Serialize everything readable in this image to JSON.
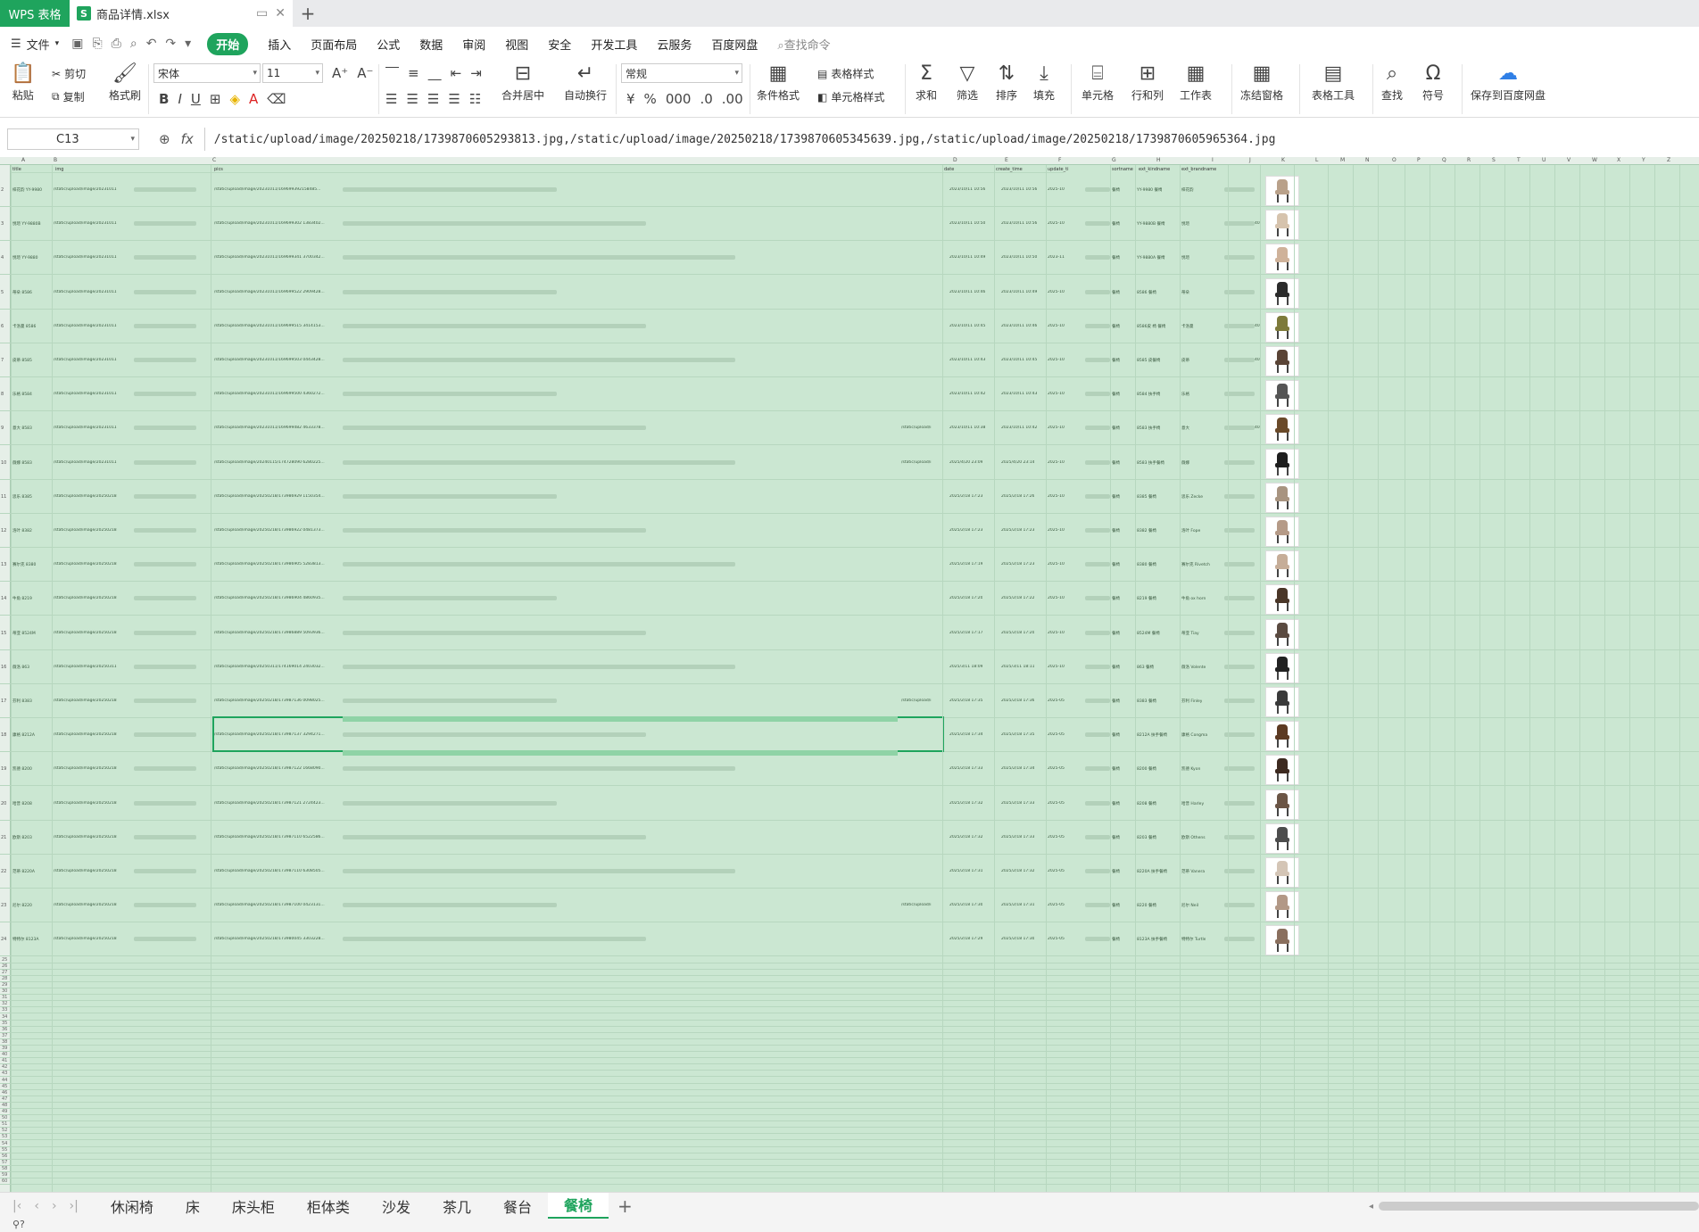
{
  "titlebar": {
    "app_label": "WPS 表格",
    "file_icon": "S",
    "file_name": "商品详情.xlsx",
    "new_tab": "+"
  },
  "menu": {
    "file": "文件",
    "items": [
      "开始",
      "插入",
      "页面布局",
      "公式",
      "数据",
      "审阅",
      "视图",
      "安全",
      "开发工具",
      "云服务",
      "百度网盘"
    ],
    "search": "查找命令"
  },
  "ribbon": {
    "paste": "粘贴",
    "cut": "剪切",
    "copy": "复制",
    "format_painter": "格式刷",
    "font_name": "宋体",
    "font_size": "11",
    "merge": "合并居中",
    "wrap": "自动换行",
    "number_format": "常规",
    "conditional": "条件格式",
    "table_style": "表格样式",
    "cell_style": "单元格样式",
    "sum": "求和",
    "filter": "筛选",
    "sort": "排序",
    "fill": "填充",
    "cell": "单元格",
    "rowcol": "行和列",
    "worksheet": "工作表",
    "freeze": "冻结窗格",
    "table_tools": "表格工具",
    "find": "查找",
    "symbol": "符号",
    "save_baidu": "保存到百度网盘",
    "bold": "B",
    "italic": "I",
    "underline": "U",
    "currency": "¥",
    "percent": "%",
    "thousands": "000"
  },
  "formula_bar": {
    "cell_ref": "C13",
    "fx": "fx",
    "content": "/static/upload/image/20250218/1739870605293813.jpg,/static/upload/image/20250218/1739870605345639.jpg,/static/upload/image/20250218/1739870605965364.jpg"
  },
  "columns": [
    "A",
    "B",
    "C",
    "D",
    "E",
    "F",
    "G",
    "H",
    "I",
    "J",
    "K",
    "L",
    "M",
    "N",
    "O",
    "P",
    "Q",
    "R",
    "S",
    "T",
    "U",
    "V",
    "W",
    "X",
    "Y",
    "Z"
  ],
  "header_row": {
    "A": "title",
    "B": "img",
    "C": "pics",
    "D": "date",
    "E": "create_time",
    "F": "update_ti",
    "G": "sortname",
    "H": "ext_kindname",
    "I": "ext_brandname"
  },
  "rows": [
    {
      "n": "2",
      "a": "梓花韵 YY-9980",
      "b": "/static/upload/image/20231011",
      "c": "/static/upload/image/20231011/169699392158485...",
      "cx": "",
      "d": "2023/10/11 10:56",
      "e": "2023/10/11 10:56",
      "f": "2025-10",
      "g": "餐椅",
      "h": "YY-9980 餐椅",
      "i": "梓花韵",
      "j": "",
      "col": "#b9a18a"
    },
    {
      "n": "3",
      "a": "悦瑄 YY-9880B",
      "b": "/static/upload/image/20231011",
      "c": "/static/upload/image/20231011/169699302 1383402...",
      "cx": "",
      "d": "2023/10/11 10:50",
      "e": "2023/10/11 10:56",
      "f": "2025-10",
      "g": "餐椅",
      "h": "YY-9880B 餐椅",
      "i": "悦瑄",
      "j": "40",
      "col": "#d6c3ad"
    },
    {
      "n": "4",
      "a": "悦瑄 YY-9880",
      "b": "/static/upload/image/20231011",
      "c": "/static/upload/image/20231011/169699341 3700342...",
      "cx": "",
      "d": "2023/10/11 10:49",
      "e": "2023/10/11 10:50",
      "f": "2023-11",
      "g": "餐椅",
      "h": "YY-9880A 餐椅",
      "i": "悦瑄",
      "j": "",
      "col": "#cfb29a"
    },
    {
      "n": "5",
      "a": "蒂朵 8586",
      "b": "/static/upload/image/20231011",
      "c": "/static/upload/image/20231011/169699522 2909428...",
      "cx": "",
      "d": "2023/10/11 10:46",
      "e": "2023/10/11 10:49",
      "f": "2025-10",
      "g": "餐椅",
      "h": "8586 餐椅",
      "i": "蒂朵",
      "j": "",
      "col": "#2b2b2b"
    },
    {
      "n": "6",
      "a": "卡洛曼 8586",
      "b": "/static/upload/image/20231011",
      "c": "/static/upload/image/20231011/169699515 3414153...",
      "cx": "",
      "d": "2023/10/11 10:45",
      "e": "2023/10/11 10:46",
      "f": "2025-10",
      "g": "餐椅",
      "h": "8586皮 椅 餐椅",
      "i": "卡洛曼",
      "j": "40",
      "col": "#7d7a3a"
    },
    {
      "n": "7",
      "a": "皮蒂 8585",
      "b": "/static/upload/image/20231011",
      "c": "/static/upload/image/20231011/169699503 0443428...",
      "cx": "",
      "d": "2023/10/11 10:43",
      "e": "2023/10/11 10:45",
      "f": "2025-10",
      "g": "餐椅",
      "h": "8585 皮餐椅",
      "i": "皮蒂",
      "j": "40",
      "col": "#5a4436"
    },
    {
      "n": "8",
      "a": "乐格 8584",
      "b": "/static/upload/image/20231011",
      "c": "/static/upload/image/20231011/169699500 4360272...",
      "cx": "",
      "d": "2023/10/11 10:42",
      "e": "2023/10/11 10:43",
      "f": "2025-10",
      "g": "餐椅",
      "h": "8584 扶手椅",
      "i": "乐格",
      "j": "",
      "col": "#555555"
    },
    {
      "n": "9",
      "a": "意大 8583",
      "b": "/static/upload/image/20231011",
      "c": "/static/upload/image/20231011/169699482 4633378...",
      "cx": "/static/upload/i",
      "d": "2023/10/11 10:38",
      "e": "2023/10/11 10:42",
      "f": "2025-10",
      "g": "餐椅",
      "h": "8583 扶手椅",
      "i": "意大",
      "j": "40",
      "col": "#6a4a2a"
    },
    {
      "n": "10",
      "a": "薇娜 8583",
      "b": "/static/upload/image/20231011",
      "c": "/static/upload/image/20240115/174728090 6280225...",
      "cx": "/static/upload/i",
      "d": "2025/4/20 23:09",
      "e": "2025/4/20 23:14",
      "f": "2025-10",
      "g": "餐椅",
      "h": "8583 扶手餐椅",
      "i": "薇娜",
      "j": "",
      "col": "#1e1e1e"
    },
    {
      "n": "11",
      "a": "思乐 8385",
      "b": "/static/upload/image/20250218",
      "c": "/static/upload/image/20250218/173986929 1150354...",
      "cx": "",
      "d": "2025/2/18 17:23",
      "e": "2025/2/18 17:26",
      "f": "2025-10",
      "g": "餐椅",
      "h": "8385 餐椅",
      "i": "思乐 Zecke",
      "j": "",
      "col": "#a89480"
    },
    {
      "n": "12",
      "a": "洛叶 8382",
      "b": "/static/upload/image/20250218",
      "c": "/static/upload/image/20250218/173986922 0481373...",
      "cx": "",
      "d": "2025/2/18 17:23",
      "e": "2025/2/18 17:23",
      "f": "2025-10",
      "g": "餐椅",
      "h": "8382 餐椅",
      "i": "洛叶 Fope",
      "j": "",
      "col": "#b59a87"
    },
    {
      "n": "13",
      "a": "赛尔克 8380",
      "b": "/static/upload/image/20250218",
      "c": "/static/upload/image/20250218/173986905 5283813...",
      "cx": "",
      "d": "2025/2/18 17:19",
      "e": "2025/2/18 17:23",
      "f": "2025-10",
      "g": "餐椅",
      "h": "8380 餐椅",
      "i": "赛尔克 Rivetch",
      "j": "",
      "col": "#c6ad98"
    },
    {
      "n": "14",
      "a": "牛角 8219",
      "b": "/static/upload/image/20250218",
      "c": "/static/upload/image/20250218/173986904 4860935...",
      "cx": "",
      "d": "2025/2/18 17:20",
      "e": "2025/2/18 17:22",
      "f": "2025-10",
      "g": "餐椅",
      "h": "8219 餐椅",
      "i": "牛角 ox horn",
      "j": "",
      "col": "#4a3628"
    },
    {
      "n": "15",
      "a": "蒂亚 8524M",
      "b": "/static/upload/image/20250218",
      "c": "/static/upload/image/20250218/173986889 5093936...",
      "cx": "",
      "d": "2025/2/18 17:17",
      "e": "2025/2/18 17:20",
      "f": "2025-10",
      "g": "餐椅",
      "h": "8524M 餐椅",
      "i": "蒂亚 Tiay",
      "j": "",
      "col": "#5a4a40"
    },
    {
      "n": "16",
      "a": "薇洛 863",
      "b": "/static/upload/image/20250311",
      "c": "/static/upload/image/20250311/174169014 2403032...",
      "cx": "",
      "d": "2025/3/11 18:09",
      "e": "2025/3/11 18:11",
      "f": "2025-10",
      "g": "餐椅",
      "h": "863 餐椅",
      "i": "薇洛 Volente",
      "j": "",
      "col": "#222222"
    },
    {
      "n": "17",
      "a": "芬利 8383",
      "b": "/static/upload/image/20250218",
      "c": "/static/upload/image/20250218/173987136 0098025...",
      "cx": "/static/upload/i",
      "d": "2025/2/18 17:35",
      "e": "2025/2/18 17:36",
      "f": "2025-05",
      "g": "餐椅",
      "h": "8383 餐椅",
      "i": "芬利 Finley",
      "j": "",
      "col": "#3a3a3a"
    },
    {
      "n": "18",
      "a": "康格 8212A",
      "b": "/static/upload/image/20250218",
      "c": "/static/upload/image/20250218/173987137 3294271...",
      "cx": "",
      "d": "2025/2/18 17:34",
      "e": "2025/2/18 17:35",
      "f": "2025-05",
      "g": "餐椅",
      "h": "8212A 扶手餐椅",
      "i": "康格 Congma",
      "j": "",
      "col": "#5c3a22"
    },
    {
      "n": "19",
      "a": "凯德 8200",
      "b": "/static/upload/image/20250218",
      "c": "/static/upload/image/20250218/173987122 1668090...",
      "cx": "",
      "d": "2025/2/18 17:33",
      "e": "2025/2/18 17:34",
      "f": "2025-05",
      "g": "餐椅",
      "h": "8200 餐椅",
      "i": "凯德 Kyon",
      "j": "",
      "col": "#3d2a20"
    },
    {
      "n": "20",
      "a": "哈普 8208",
      "b": "/static/upload/image/20250218",
      "c": "/static/upload/image/20250218/173987121 2724423...",
      "cx": "",
      "d": "2025/2/18 17:32",
      "e": "2025/2/18 17:33",
      "f": "2025-05",
      "g": "餐椅",
      "h": "8208 餐椅",
      "i": "哈普 Harley",
      "j": "",
      "col": "#6b5545"
    },
    {
      "n": "21",
      "a": "欧斯 8203",
      "b": "/static/upload/image/20250218",
      "c": "/static/upload/image/20250218/173987110 6522586...",
      "cx": "",
      "d": "2025/2/18 17:32",
      "e": "2025/2/18 17:33",
      "f": "2025-05",
      "g": "餐椅",
      "h": "8203 餐椅",
      "i": "欧斯 Othens",
      "j": "",
      "col": "#4d4d4d"
    },
    {
      "n": "22",
      "a": "范蒂 8220A",
      "b": "/static/upload/image/20250218",
      "c": "/static/upload/image/20250218/173987110 6308505...",
      "cx": "",
      "d": "2025/2/18 17:31",
      "e": "2025/2/18 17:32",
      "f": "2025-05",
      "g": "餐椅",
      "h": "8220A 扶手餐椅",
      "i": "范蒂 Vanera",
      "j": "",
      "col": "#d4c5b6"
    },
    {
      "n": "23",
      "a": "尼尔 8220",
      "b": "/static/upload/image/20250218",
      "c": "/static/upload/image/20250218/173987100 0423131...",
      "cx": "/static/upload/i",
      "d": "2025/2/18 17:30",
      "e": "2025/2/18 17:31",
      "f": "2025-05",
      "g": "餐椅",
      "h": "8220 餐椅",
      "i": "尼尔 Neil",
      "j": "",
      "col": "#b29886"
    },
    {
      "n": "24",
      "a": "特特尔 8123A",
      "b": "/static/upload/image/20250218",
      "c": "/static/upload/image/20250218/173980045 3303228...",
      "cx": "",
      "d": "2025/2/18 17:29",
      "e": "2025/2/18 17:30",
      "f": "2025-05",
      "g": "餐椅",
      "h": "8123A 扶手餐椅",
      "i": "特特尔 Turtle",
      "j": "",
      "col": "#8a6f5e"
    }
  ],
  "empty_rows": [
    "25",
    "26",
    "27",
    "28",
    "29",
    "30",
    "31",
    "32",
    "33",
    "34",
    "35",
    "36",
    "37",
    "38",
    "39",
    "40",
    "41",
    "42",
    "43",
    "44",
    "45",
    "46",
    "47",
    "48",
    "49",
    "50",
    "51",
    "52",
    "53",
    "54",
    "55",
    "56",
    "57",
    "58",
    "59",
    "60"
  ],
  "sheets": [
    "休闲椅",
    "床",
    "床头柜",
    "柜体类",
    "沙发",
    "茶几",
    "餐台",
    "餐椅"
  ],
  "active_sheet": "餐椅",
  "sheet_add": "+",
  "status": "⚲?",
  "accent": "#1fa45d"
}
